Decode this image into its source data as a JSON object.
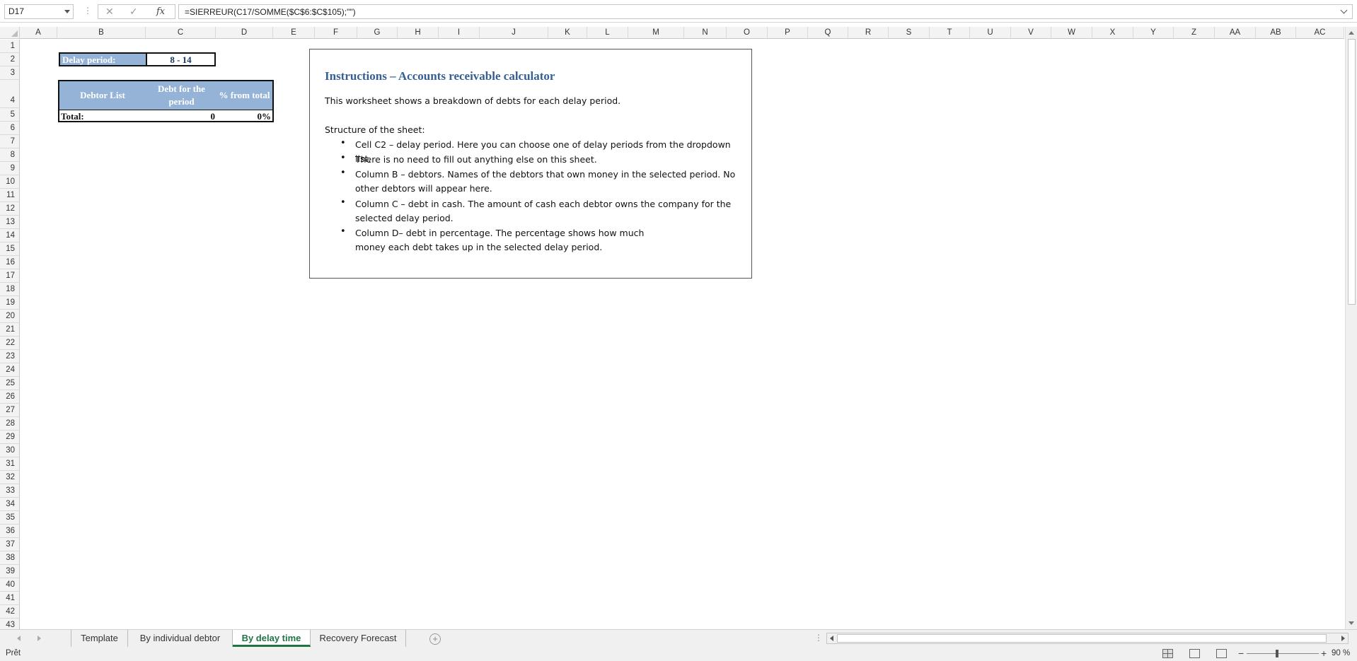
{
  "formula_bar": {
    "name_box": "D17",
    "cancel_icon": "✕",
    "enter_icon": "✓",
    "fx_label": "fx",
    "formula": "=SIERREUR(C17/SOMME($C$6:$C$105);\"\")"
  },
  "columns": [
    "A",
    "B",
    "C",
    "D",
    "E",
    "F",
    "G",
    "H",
    "I",
    "J",
    "K",
    "L",
    "M",
    "N",
    "O",
    "P",
    "Q",
    "R",
    "S",
    "T",
    "U",
    "V",
    "W",
    "X",
    "Y",
    "Z",
    "AA",
    "AB",
    "AC"
  ],
  "rows": [
    "1",
    "2",
    "3",
    "4",
    "5",
    "6",
    "7",
    "8",
    "9",
    "10",
    "11",
    "12",
    "13",
    "14",
    "15",
    "16",
    "17",
    "18",
    "19",
    "20",
    "21",
    "22",
    "23",
    "24",
    "25",
    "26",
    "27",
    "28",
    "29",
    "30",
    "31",
    "32",
    "33",
    "34",
    "35",
    "36",
    "37",
    "38",
    "39",
    "40",
    "41",
    "42",
    "43"
  ],
  "sheet": {
    "delay_label": "Delay period:",
    "delay_value": "8 - 14",
    "table": {
      "headers": [
        "Debtor List",
        "Debt for the period",
        "% from total"
      ],
      "total_label": "Total:",
      "total_debt": "0",
      "total_percent": "0%"
    }
  },
  "instructions": {
    "title": "Instructions – Accounts receivable calculator",
    "intro": "This worksheet shows a breakdown of debts for each delay period.",
    "structure_heading": "Structure of the sheet:",
    "bullets": [
      "Cell C2 – delay period. Here you can choose one of delay periods from the dropdown list.",
      "There is no need to fill out anything else on this sheet.",
      "Column B – debtors. Names of the debtors that own money in the selected period. No other debtors will appear here.",
      "Column C – debt in cash. The amount of cash each debtor owns the company for the selected delay period.",
      "Column D– debt in percentage. The percentage shows how much money each debt takes up in the selected delay period."
    ]
  },
  "tabs": [
    "Template",
    "By individual debtor",
    "By delay time",
    "Recovery Forecast"
  ],
  "active_tab": "By delay time",
  "status": {
    "text": "Prêt",
    "zoom": "90 %"
  },
  "icons": {
    "add_sheet": "add-sheet-icon",
    "name_box_dropdown": "chevron-down-icon"
  }
}
